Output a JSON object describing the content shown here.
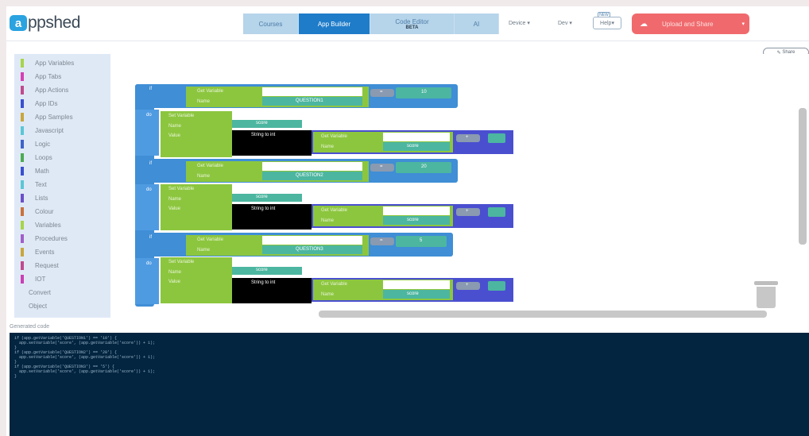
{
  "header": {
    "logo_mark": "a",
    "logo_text": "ppshed",
    "tabs": [
      {
        "label": "Courses",
        "sub": ""
      },
      {
        "label": "App Builder",
        "sub": ""
      },
      {
        "label": "Code Editor",
        "sub": "BETA"
      },
      {
        "label": "AI",
        "sub": ""
      }
    ],
    "menus": {
      "device": "Device",
      "dev": "Dev",
      "help": "Help"
    },
    "help_badge": "NEW",
    "upload_label": "Upload and Share",
    "share_label": "Share"
  },
  "toolbox": {
    "items": [
      {
        "label": "App Variables",
        "color": "#a6d44a"
      },
      {
        "label": "App Tabs",
        "color": "#d63fb5"
      },
      {
        "label": "App Actions",
        "color": "#c04a8e"
      },
      {
        "label": "App IDs",
        "color": "#3a4fd0"
      },
      {
        "label": "App Samples",
        "color": "#c9a63d"
      },
      {
        "label": "Javascript",
        "color": "#5cc6d6"
      },
      {
        "label": "Logic",
        "color": "#3f63c9"
      },
      {
        "label": "Loops",
        "color": "#4caa52"
      },
      {
        "label": "Math",
        "color": "#3a4fd0"
      },
      {
        "label": "Text",
        "color": "#5cc6d6"
      },
      {
        "label": "Lists",
        "color": "#6b4fc9"
      },
      {
        "label": "Colour",
        "color": "#c9713d"
      },
      {
        "label": "Variables",
        "color": "#a6d44a"
      },
      {
        "label": "Procedures",
        "color": "#a05fc9"
      },
      {
        "label": "Events",
        "color": "#c9a63d"
      },
      {
        "label": "Request",
        "color": "#c04a8e"
      },
      {
        "label": "IOT",
        "color": "#c93fb5"
      }
    ],
    "plain_items": [
      "Convert",
      "Object"
    ]
  },
  "blocks": {
    "if_label": "if",
    "do_label": "do",
    "get_variable": "Get Variable",
    "set_variable": "Set Variable",
    "name_label": "Name",
    "value_label": "Value",
    "string_to_int": "String to int",
    "question1": "QUESTION1",
    "question2": "QUESTION2",
    "question3": "QUESTION3",
    "score": "score",
    "answer1": "10",
    "answer2": "20",
    "answer3": "5",
    "eq": "=",
    "plus": "+"
  },
  "generated_label": "Generated code",
  "code_lines": [
    "if (app.getVariable('QUESTION1') == '10') {",
    "  app.setVariable('score', (app.getVariable('score')) + 1);",
    "}",
    "if (app.getVariable('QUESTION2') == '20') {",
    "  app.setVariable('score', (app.getVariable('score')) + 1);",
    "}",
    "if (app.getVariable('QUESTION3') == '5') {",
    "  app.setVariable('score', (app.getVariable('score')) + 1);",
    "}"
  ]
}
